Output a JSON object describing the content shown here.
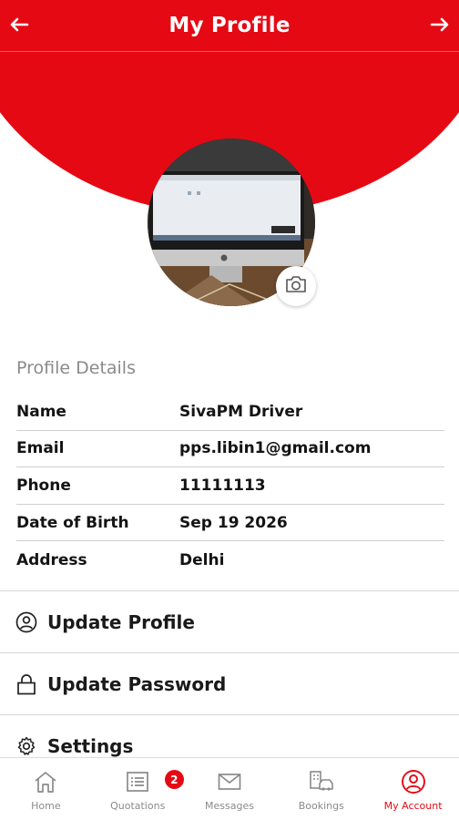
{
  "header": {
    "title": "My Profile",
    "back_icon": "arrow-left-icon",
    "forward_icon": "arrow-right-icon",
    "color": "#e50914"
  },
  "profile_photo": {
    "camera_icon": "camera-icon"
  },
  "profile_details": {
    "section_title": "Profile Details",
    "rows": [
      {
        "label": "Name",
        "value": "SivaPM Driver"
      },
      {
        "label": "Email",
        "value": "pps.libin1@gmail.com"
      },
      {
        "label": "Phone",
        "value": "11111113"
      },
      {
        "label": "Date of Birth",
        "value": "Sep 19 2026"
      },
      {
        "label": "Address",
        "value": "Delhi"
      }
    ]
  },
  "menu": [
    {
      "label": "Update Profile",
      "icon": "user-circle-icon"
    },
    {
      "label": "Update Password",
      "icon": "lock-icon"
    },
    {
      "label": "Settings",
      "icon": "gear-icon"
    }
  ],
  "tabbar": {
    "active_color": "#e50914",
    "tabs": [
      {
        "label": "Home",
        "icon": "home-icon"
      },
      {
        "label": "Quotations",
        "icon": "list-icon",
        "badge": "2"
      },
      {
        "label": "Messages",
        "icon": "mail-icon"
      },
      {
        "label": "Bookings",
        "icon": "bookings-icon"
      },
      {
        "label": "My Account",
        "icon": "account-icon",
        "active": true
      }
    ]
  }
}
